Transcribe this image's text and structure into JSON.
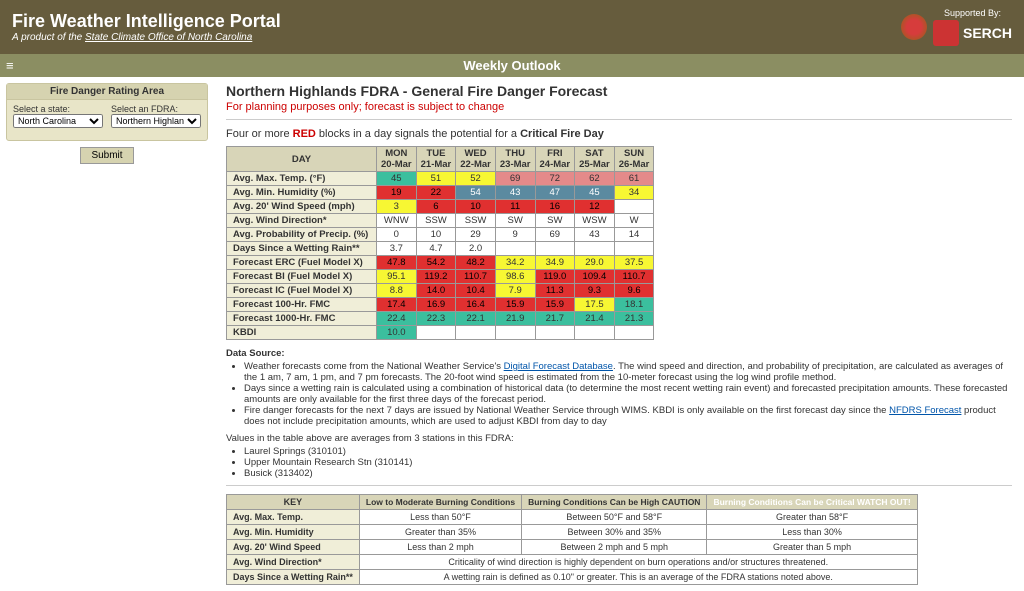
{
  "header": {
    "title": "Fire Weather Intelligence Portal",
    "subtitle_prefix": "A product of the ",
    "subtitle_link": "State Climate Office of North Carolina",
    "supported_by": "Supported By:",
    "serch": "SERCH"
  },
  "section_title": "Weekly Outlook",
  "sidebar": {
    "panel_title": "Fire Danger Rating Area",
    "state_label": "Select a state:",
    "state_value": "North Carolina",
    "fdra_label": "Select an FDRA:",
    "fdra_value": "Northern Highlands",
    "submit": "Submit"
  },
  "content": {
    "title": "Northern Highlands FDRA - General Fire Danger Forecast",
    "warning": "For planning purposes only; forecast is subject to change",
    "critical_prefix": "Four or more ",
    "critical_red": "RED",
    "critical_suffix": " blocks in a day signals the potential for a ",
    "critical_bold": "Critical Fire Day"
  },
  "table": {
    "headers": [
      "DAY",
      "MON 20-Mar",
      "TUE 21-Mar",
      "WED 22-Mar",
      "THU 23-Mar",
      "FRI 24-Mar",
      "SAT 25-Mar",
      "SUN 26-Mar"
    ],
    "rows": [
      {
        "label": "Avg. Max. Temp. (°F)",
        "cells": [
          {
            "v": "45",
            "c": "grn"
          },
          {
            "v": "51",
            "c": "yel"
          },
          {
            "v": "52",
            "c": "yel"
          },
          {
            "v": "69",
            "c": "pnk"
          },
          {
            "v": "72",
            "c": "pnk"
          },
          {
            "v": "62",
            "c": "pnk"
          },
          {
            "v": "61",
            "c": "pnk"
          }
        ]
      },
      {
        "label": "Avg. Min. Humidity (%)",
        "cells": [
          {
            "v": "19",
            "c": "red"
          },
          {
            "v": "22",
            "c": "red"
          },
          {
            "v": "54",
            "c": "dbl"
          },
          {
            "v": "43",
            "c": "dbl"
          },
          {
            "v": "47",
            "c": "dbl"
          },
          {
            "v": "45",
            "c": "dbl"
          },
          {
            "v": "34",
            "c": "yel"
          }
        ]
      },
      {
        "label": "Avg. 20' Wind Speed (mph)",
        "cells": [
          {
            "v": "3",
            "c": "yel"
          },
          {
            "v": "6",
            "c": "red"
          },
          {
            "v": "10",
            "c": "red"
          },
          {
            "v": "11",
            "c": "red"
          },
          {
            "v": "16",
            "c": "red"
          },
          {
            "v": "12",
            "c": "red"
          },
          {
            "v": ""
          }
        ]
      },
      {
        "label": "Avg. Wind Direction*",
        "cells": [
          {
            "v": "WNW"
          },
          {
            "v": "SSW"
          },
          {
            "v": "SSW"
          },
          {
            "v": "SW"
          },
          {
            "v": "SW"
          },
          {
            "v": "WSW"
          },
          {
            "v": "W"
          }
        ]
      },
      {
        "label": "Avg. Probability of Precip. (%)",
        "cells": [
          {
            "v": "0"
          },
          {
            "v": "10"
          },
          {
            "v": "29"
          },
          {
            "v": "9"
          },
          {
            "v": "69"
          },
          {
            "v": "43"
          },
          {
            "v": "14"
          }
        ]
      },
      {
        "label": "Days Since a Wetting Rain**",
        "cells": [
          {
            "v": "3.7"
          },
          {
            "v": "4.7"
          },
          {
            "v": "2.0"
          },
          {
            "v": ""
          },
          {
            "v": ""
          },
          {
            "v": ""
          },
          {
            "v": ""
          }
        ]
      },
      {
        "label": "Forecast ERC (Fuel Model X)",
        "cells": [
          {
            "v": "47.8",
            "c": "red"
          },
          {
            "v": "54.2",
            "c": "red"
          },
          {
            "v": "48.2",
            "c": "red"
          },
          {
            "v": "34.2",
            "c": "yel"
          },
          {
            "v": "34.9",
            "c": "yel"
          },
          {
            "v": "29.0",
            "c": "yel"
          },
          {
            "v": "37.5",
            "c": "yel"
          }
        ]
      },
      {
        "label": "Forecast BI (Fuel Model X)",
        "cells": [
          {
            "v": "95.1",
            "c": "yel"
          },
          {
            "v": "119.2",
            "c": "red"
          },
          {
            "v": "110.7",
            "c": "red"
          },
          {
            "v": "98.6",
            "c": "yel"
          },
          {
            "v": "119.0",
            "c": "red"
          },
          {
            "v": "109.4",
            "c": "red"
          },
          {
            "v": "110.7",
            "c": "red"
          }
        ]
      },
      {
        "label": "Forecast IC (Fuel Model X)",
        "cells": [
          {
            "v": "8.8",
            "c": "yel"
          },
          {
            "v": "14.0",
            "c": "red"
          },
          {
            "v": "10.4",
            "c": "red"
          },
          {
            "v": "7.9",
            "c": "yel"
          },
          {
            "v": "11.3",
            "c": "red"
          },
          {
            "v": "9.3",
            "c": "red"
          },
          {
            "v": "9.6",
            "c": "red"
          }
        ]
      },
      {
        "label": "Forecast 100-Hr. FMC",
        "cells": [
          {
            "v": "17.4",
            "c": "red"
          },
          {
            "v": "16.9",
            "c": "red"
          },
          {
            "v": "16.4",
            "c": "red"
          },
          {
            "v": "15.9",
            "c": "red"
          },
          {
            "v": "15.9",
            "c": "red"
          },
          {
            "v": "17.5",
            "c": "yel"
          },
          {
            "v": "18.1",
            "c": "grn"
          }
        ]
      },
      {
        "label": "Forecast 1000-Hr. FMC",
        "cells": [
          {
            "v": "22.4",
            "c": "grn"
          },
          {
            "v": "22.3",
            "c": "grn"
          },
          {
            "v": "22.1",
            "c": "grn"
          },
          {
            "v": "21.9",
            "c": "grn"
          },
          {
            "v": "21.7",
            "c": "grn"
          },
          {
            "v": "21.4",
            "c": "grn"
          },
          {
            "v": "21.3",
            "c": "grn"
          }
        ]
      },
      {
        "label": "KBDI",
        "cells": [
          {
            "v": "10.0",
            "c": "grn"
          },
          {
            "v": ""
          },
          {
            "v": ""
          },
          {
            "v": ""
          },
          {
            "v": ""
          },
          {
            "v": ""
          },
          {
            "v": ""
          }
        ]
      }
    ]
  },
  "datasource": {
    "heading": "Data Source:",
    "b1a": "Weather forecasts come from the National Weather Service's ",
    "b1link": "Digital Forecast Database",
    "b1b": ". The wind speed and direction, and probability of precipitation, are calculated as averages of the 1 am, 7 am, 1 pm, and 7 pm forecasts. The 20-foot wind speed is estimated from the 10-meter forecast using the log wind profile method.",
    "b2": "Days since a wetting rain is calculated using a combination of historical data (to determine the most recent wetting rain event) and forecasted precipitation amounts. These forecasted amounts are only available for the first three days of the forecast period.",
    "b3a": "Fire danger forecasts for the next 7 days are issued by National Weather Service through WIMS. KBDI is only available on the first forecast day since the ",
    "b3link": "NFDRS Forecast",
    "b3b": " product does not include precipitation amounts, which are used to adjust KBDI from day to day"
  },
  "stations": {
    "intro": "Values in the table above are averages from 3 stations in this FDRA:",
    "list": [
      "Laurel Springs (310101)",
      "Upper Mountain Research Stn (310141)",
      "Busick (313402)"
    ]
  },
  "key": {
    "headers": {
      "key": "KEY",
      "low": "Low to Moderate Burning Conditions",
      "caution": "Burning Conditions Can be High CAUTION",
      "critical": "Burning Conditions Can be Critical WATCH OUT!"
    },
    "rows": [
      {
        "label": "Avg. Max. Temp.",
        "low": "Less than 50°F",
        "mid": "Between 50°F and 58°F",
        "hi": "Greater than 58°F"
      },
      {
        "label": "Avg. Min. Humidity",
        "low": "Greater than 35%",
        "mid": "Between 30% and 35%",
        "hi": "Less than 30%"
      },
      {
        "label": "Avg. 20' Wind Speed",
        "low": "Less than 2 mph",
        "mid": "Between 2 mph and 5 mph",
        "hi": "Greater than 5 mph"
      },
      {
        "label": "Avg. Wind Direction*",
        "span": "Criticality of wind direction is highly dependent on burn operations and/or structures threatened."
      },
      {
        "label": "Days Since a Wetting Rain**",
        "span": "A wetting rain is defined as 0.10\" or greater. This is an average of the FDRA stations noted above."
      }
    ]
  }
}
